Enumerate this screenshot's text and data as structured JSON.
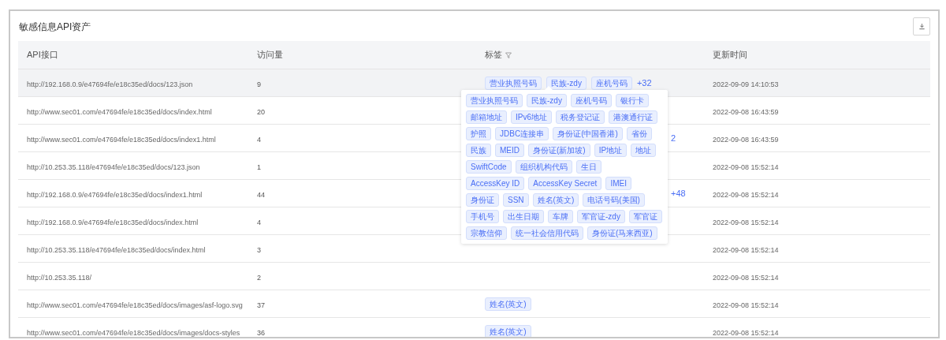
{
  "title": "敏感信息API资产",
  "columns": [
    {
      "label": "API接口",
      "filter": false
    },
    {
      "label": "访问量",
      "filter": false
    },
    {
      "label": "标签",
      "filter": true
    },
    {
      "label": "更新时间",
      "filter": false
    }
  ],
  "rows": [
    {
      "api": "http://192.168.0.9/e47694fe/e18c35ed/docs/123.json",
      "visits": "9",
      "tags": [
        "营业执照号码",
        "民族-zdy",
        "座机号码"
      ],
      "more": "+32",
      "time": "2022-09-09 14:10:53",
      "hovered": true
    },
    {
      "api": "http://www.sec01.com/e47694fe/e18c35ed/docs/index.html",
      "visits": "20",
      "tags": [],
      "time": "2022-09-08 16:43:59",
      "hovered": false
    },
    {
      "api": "http://www.sec01.com/e47694fe/e18c35ed/docs/index1.html",
      "visits": "4",
      "tags": [],
      "more": "2",
      "time": "2022-09-08 16:43:59",
      "hovered": false
    },
    {
      "api": "http://10.253.35.118/e47694fe/e18c35ed/docs/123.json",
      "visits": "1",
      "tags": [],
      "time": "2022-09-08 15:52:14",
      "hovered": false
    },
    {
      "api": "http://192.168.0.9/e47694fe/e18c35ed/docs/index1.html",
      "visits": "44",
      "tags": [],
      "more": "+48",
      "time": "2022-09-08 15:52:14",
      "hovered": false
    },
    {
      "api": "http://192.168.0.9/e47694fe/e18c35ed/docs/index.html",
      "visits": "4",
      "tags": [],
      "time": "2022-09-08 15:52:14",
      "hovered": false
    },
    {
      "api": "http://10.253.35.118/e47694fe/e18c35ed/docs/index.html",
      "visits": "3",
      "tags": [],
      "time": "2022-09-08 15:52:14",
      "hovered": false
    },
    {
      "api": "http://10.253.35.118/",
      "visits": "2",
      "tags": [],
      "time": "2022-09-08 15:52:14",
      "hovered": false
    },
    {
      "api": "http://www.sec01.com/e47694fe/e18c35ed/docs/images/asf-logo.svg",
      "visits": "37",
      "tags": [
        "姓名(英文)"
      ],
      "time": "2022-09-08 15:52:14",
      "hovered": false
    },
    {
      "api": "http://www.sec01.com/e47694fe/e18c35ed/docs/images/docs-styles",
      "visits": "36",
      "tags": [
        "姓名(英文)"
      ],
      "time": "2022-09-08 15:52:14",
      "hovered": false
    }
  ],
  "popover": {
    "tags": [
      "营业执照号码",
      "民族-zdy",
      "座机号码",
      "银行卡",
      "邮箱地址",
      "IPv6地址",
      "税务登记证",
      "港澳通行证",
      "护照",
      "JDBC连接串",
      "身份证(中国香港)",
      "省份",
      "民族",
      "MEID",
      "身份证(新加坡)",
      "IP地址",
      "地址",
      "SwiftCode",
      "组织机构代码",
      "生日",
      "AccessKey ID",
      "AccessKey Secret",
      "IMEI",
      "身份证",
      "SSN",
      "姓名(英文)",
      "电话号码(美国)",
      "手机号",
      "出生日期",
      "车牌",
      "军官证-zdy",
      "军官证",
      "宗教信仰",
      "统一社会信用代码",
      "身份证(马来西亚)"
    ]
  }
}
